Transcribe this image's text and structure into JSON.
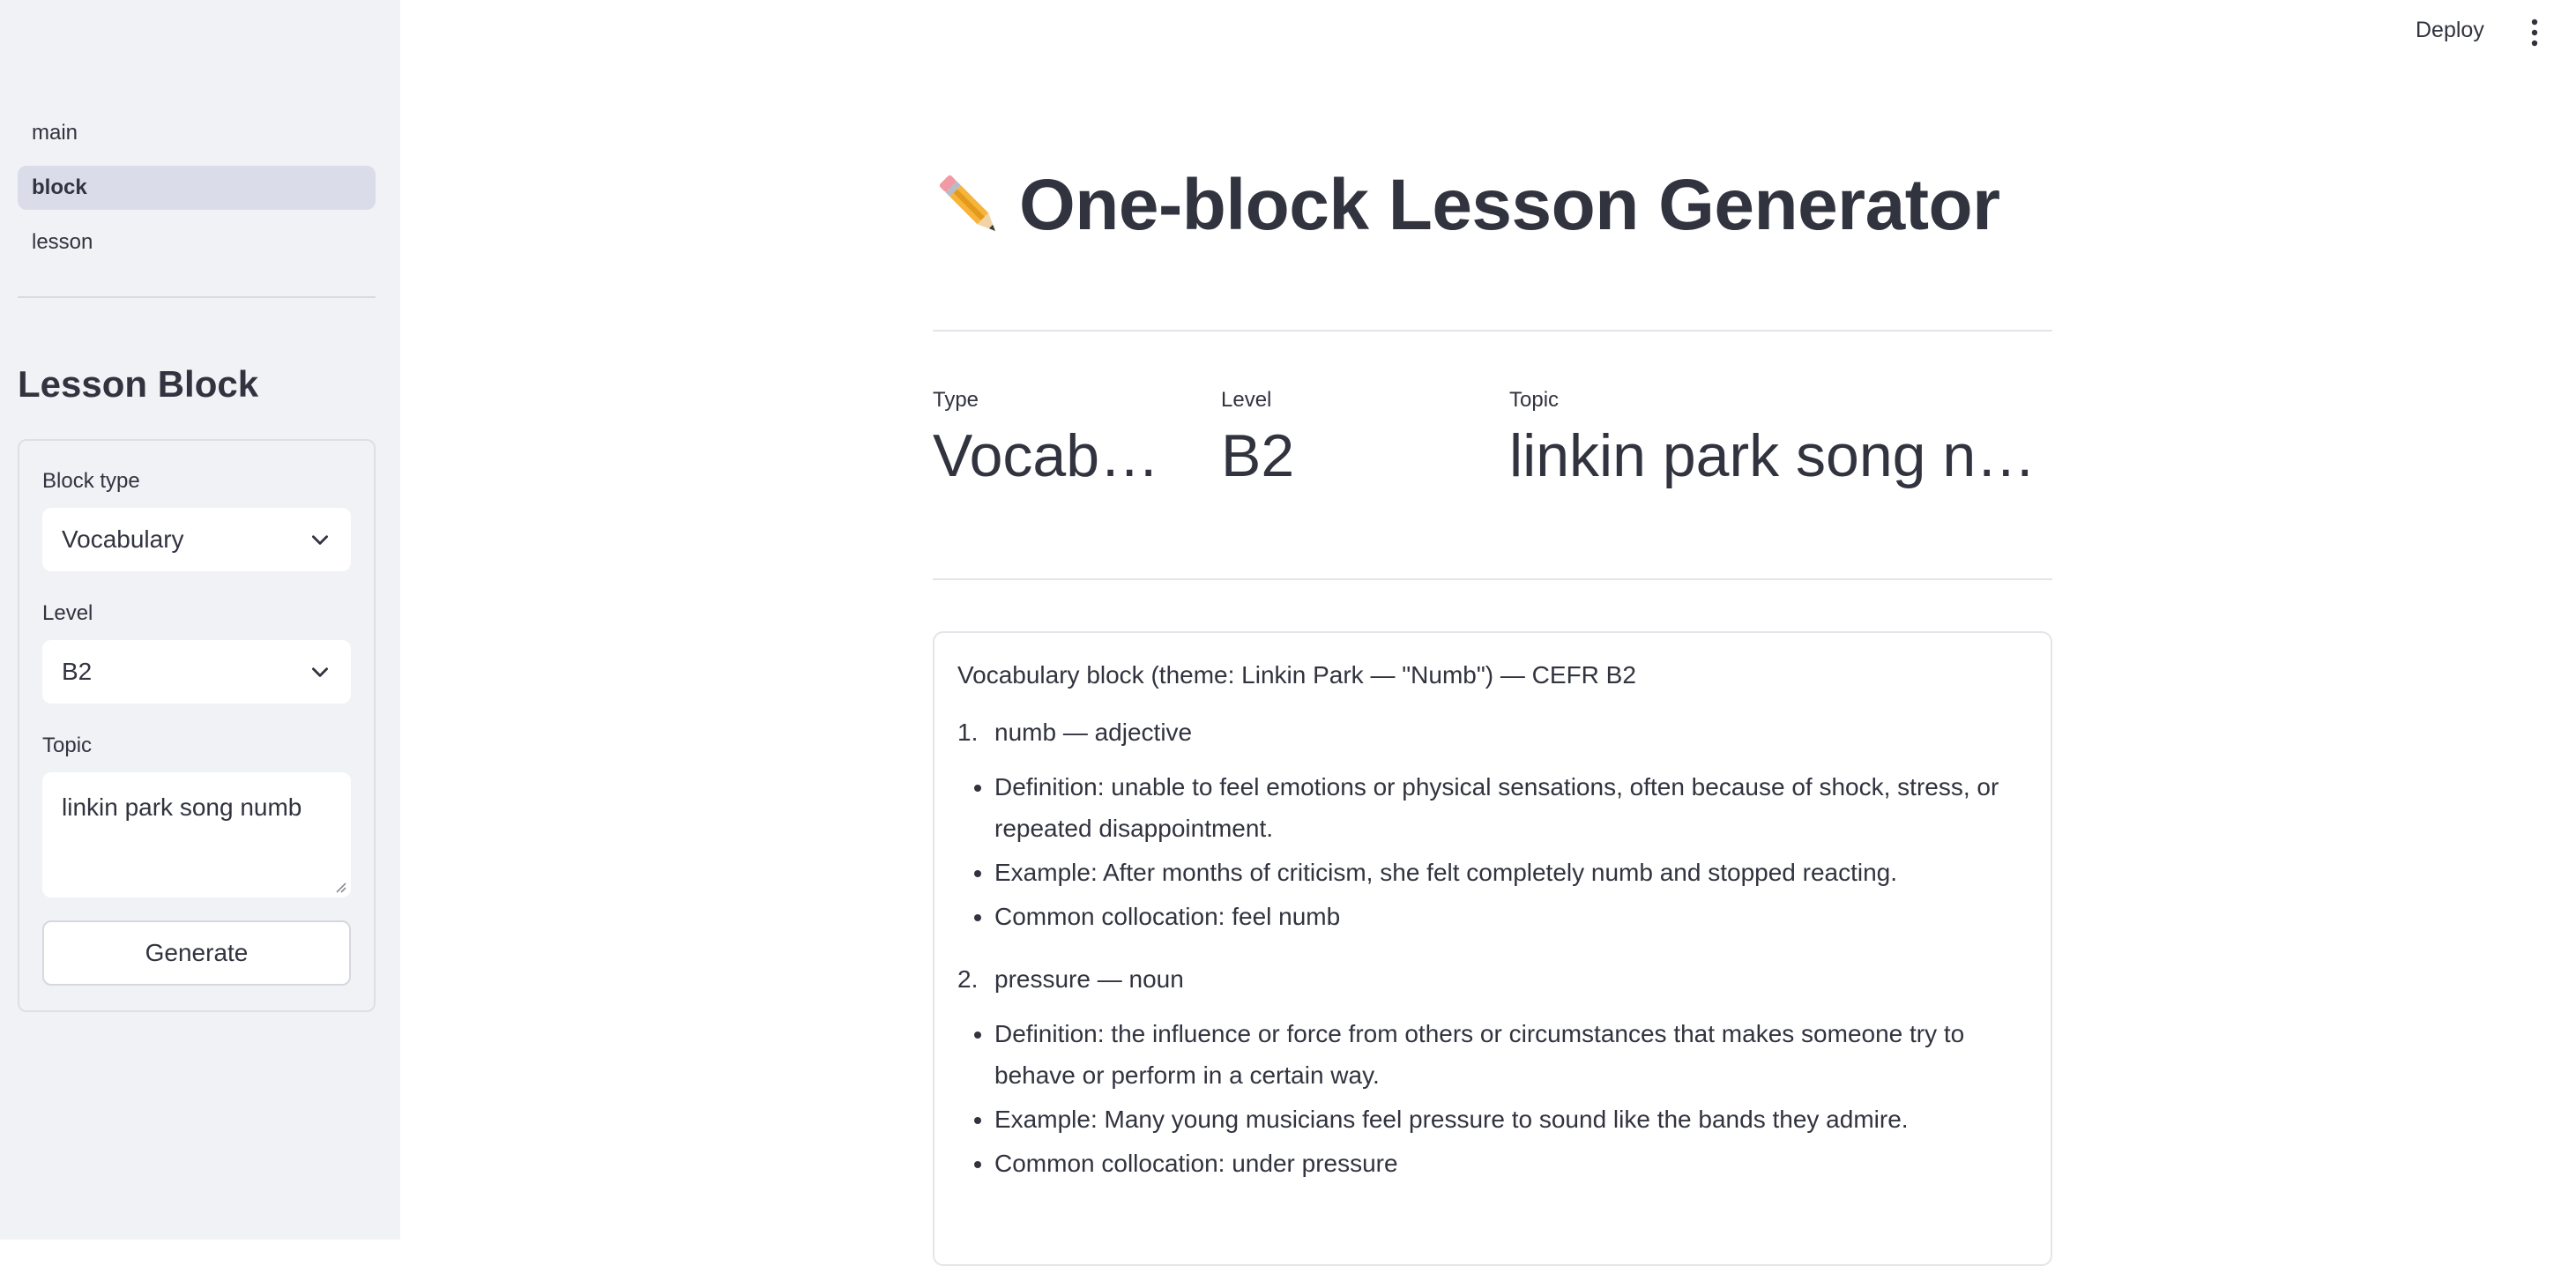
{
  "sidebar": {
    "nav": [
      {
        "label": "main"
      },
      {
        "label": "block"
      },
      {
        "label": "lesson"
      }
    ],
    "heading": "Lesson Block",
    "form": {
      "block_type_label": "Block type",
      "block_type_value": "Vocabulary",
      "level_label": "Level",
      "level_value": "B2",
      "topic_label": "Topic",
      "topic_value": "linkin park song numb",
      "generate_label": "Generate"
    }
  },
  "header": {
    "deploy_label": "Deploy",
    "menu_icon": "kebab-menu-icon"
  },
  "main": {
    "title_icon": "pencil-icon",
    "title": "One-block Lesson Generator",
    "metrics": [
      {
        "label": "Type",
        "value": "Vocabul…"
      },
      {
        "label": "Level",
        "value": "B2"
      },
      {
        "label": "Topic",
        "value": "linkin park song numb"
      }
    ],
    "content": {
      "intro": "Vocabulary block (theme: Linkin Park — \"Numb\") — CEFR B2",
      "entries": [
        {
          "number": "1.",
          "headword": "numb — adjective",
          "definition": "Definition: unable to feel emotions or physical sensations, often because of shock, stress, or repeated disappointment.",
          "example": "Example: After months of criticism, she felt completely numb and stopped reacting.",
          "collocation": "Common collocation: feel numb"
        },
        {
          "number": "2.",
          "headword": "pressure — noun",
          "definition": "Definition: the influence or force from others or circumstances that makes someone try to behave or perform in a certain way.",
          "example": "Example: Many young musicians feel pressure to sound like the bands they admire.",
          "collocation": "Common collocation: under pressure"
        }
      ]
    }
  },
  "colors": {
    "sidebar_bg": "#f0f2f6",
    "active_nav_bg": "#dadde9",
    "text": "#31333f"
  }
}
